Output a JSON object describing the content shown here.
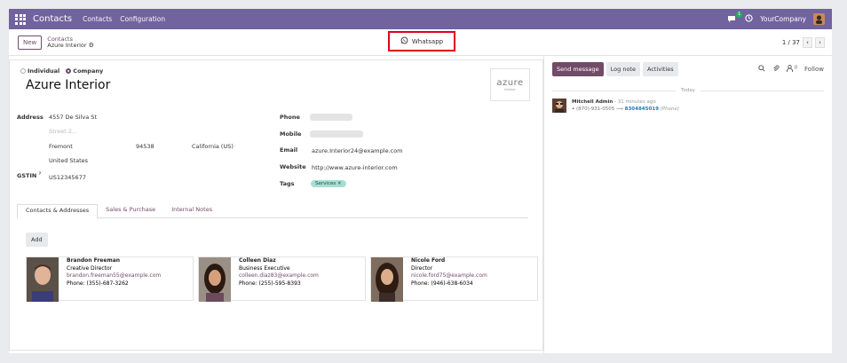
{
  "topbar": {
    "app_name": "Contacts",
    "menu": [
      "Contacts",
      "Configuration"
    ],
    "chat_badge": "1",
    "company": "YourCompany",
    "accent": "#71639e"
  },
  "control_panel": {
    "new_label": "New",
    "breadcrumb_root": "Contacts",
    "breadcrumb_current": "Azure Interior",
    "whatsapp_label": "Whatsapp",
    "pager": "1 / 37"
  },
  "form": {
    "type_individual": "Individual",
    "type_company": "Company",
    "name": "Azure Interior",
    "logo_text": "azure",
    "logo_sub": "interior",
    "address_label": "Address",
    "street": "4557 De Silva St",
    "street2_placeholder": "Street 2...",
    "city": "Fremont",
    "zip": "94538",
    "state": "California (US)",
    "country": "United States",
    "gstin_label": "GSTIN",
    "gstin_help": "?",
    "gstin": "US12345677",
    "phone_label": "Phone",
    "mobile_label": "Mobile",
    "email_label": "Email",
    "email": "azure.Interior24@example.com",
    "website_label": "Website",
    "website": "http://www.azure-interior.com",
    "tags_label": "Tags",
    "tag": "Services",
    "tag_remove": "✕"
  },
  "tabs": [
    "Contacts & Addresses",
    "Sales & Purchase",
    "Internal Notes"
  ],
  "add_label": "Add",
  "contacts": [
    {
      "name": "Brandon Freeman",
      "title": "Creative Director",
      "email": "brandon.freeman55@example.com",
      "phone": "Phone: (355)-687-3262"
    },
    {
      "name": "Colleen Diaz",
      "title": "Business Executive",
      "email": "colleen.diaz83@example.com",
      "phone": "Phone: (255)-595-8393"
    },
    {
      "name": "Nicole Ford",
      "title": "Director",
      "email": "nicole.ford75@example.com",
      "phone": "Phone: (946)-638-6034"
    }
  ],
  "chatter": {
    "send_message": "Send message",
    "log_note": "Log note",
    "activities": "Activities",
    "follower_count": "0",
    "follow": "Follow",
    "today": "Today",
    "author": "Mitchell Admin",
    "time": "- 31 minutes ago",
    "bullet": "•",
    "old_value": "(870)-931-0505",
    "arrow": "⟶",
    "new_value": "8304845019",
    "field": "(Phone)"
  }
}
